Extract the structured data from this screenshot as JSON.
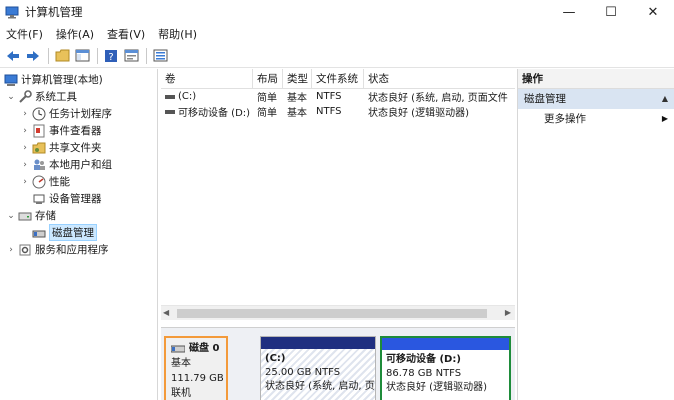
{
  "window": {
    "title": "计算机管理",
    "controls": {
      "minimize": "—",
      "maximize": "☐",
      "close": "✕"
    }
  },
  "menu": [
    "文件(F)",
    "操作(A)",
    "查看(V)",
    "帮助(H)"
  ],
  "toolbar_icons": [
    "back-arrow-icon",
    "forward-arrow-icon",
    "folder-up-icon",
    "show-hide-tree-icon",
    "help-icon",
    "properties-icon",
    "export-list-icon"
  ],
  "tree": {
    "root": "计算机管理(本地)",
    "items": [
      {
        "label": "系统工具",
        "level": 1,
        "expanded": true,
        "icon": "tools-icon"
      },
      {
        "label": "任务计划程序",
        "level": 2,
        "icon": "clock-icon"
      },
      {
        "label": "事件查看器",
        "level": 2,
        "icon": "event-viewer-icon"
      },
      {
        "label": "共享文件夹",
        "level": 2,
        "icon": "shared-folder-icon"
      },
      {
        "label": "本地用户和组",
        "level": 2,
        "icon": "users-icon"
      },
      {
        "label": "性能",
        "level": 2,
        "icon": "performance-icon"
      },
      {
        "label": "设备管理器",
        "level": 2,
        "icon": "device-manager-icon"
      },
      {
        "label": "存储",
        "level": 1,
        "expanded": true,
        "icon": "storage-icon"
      },
      {
        "label": "磁盘管理",
        "level": 2,
        "selected": true,
        "icon": "disk-icon"
      },
      {
        "label": "服务和应用程序",
        "level": 1,
        "icon": "services-icon"
      }
    ]
  },
  "volume_list": {
    "columns": [
      "卷",
      "布局",
      "类型",
      "文件系统",
      "状态"
    ],
    "rows": [
      {
        "volume": "(C:)",
        "layout": "简单",
        "type": "基本",
        "fs": "NTFS",
        "status": "状态良好 (系统, 启动, 页面文件"
      },
      {
        "volume": "可移动设备 (D:)",
        "layout": "简单",
        "type": "基本",
        "fs": "NTFS",
        "status": "状态良好 (逻辑驱动器)"
      }
    ]
  },
  "disk_graph": {
    "disk": {
      "name": "磁盘 0",
      "type": "基本",
      "size": "111.79 GB",
      "status": "联机"
    },
    "partitions": [
      {
        "name": "(C:)",
        "size": "25.00 GB NTFS",
        "status": "状态良好 (系统, 启动, 页"
      },
      {
        "name": "可移动设备  (D:)",
        "size": "86.78 GB NTFS",
        "status": "状态良好 (逻辑驱动器)"
      }
    ]
  },
  "actions": {
    "header": "操作",
    "section": "磁盘管理",
    "more": "更多操作"
  },
  "colors": {
    "selection": "#cce8ff",
    "disk_label_border": "#f39a3a",
    "primary_bar": "#1f2f80",
    "logical_bar": "#2a57e0",
    "selected_partition_border": "#1e8c3a"
  }
}
